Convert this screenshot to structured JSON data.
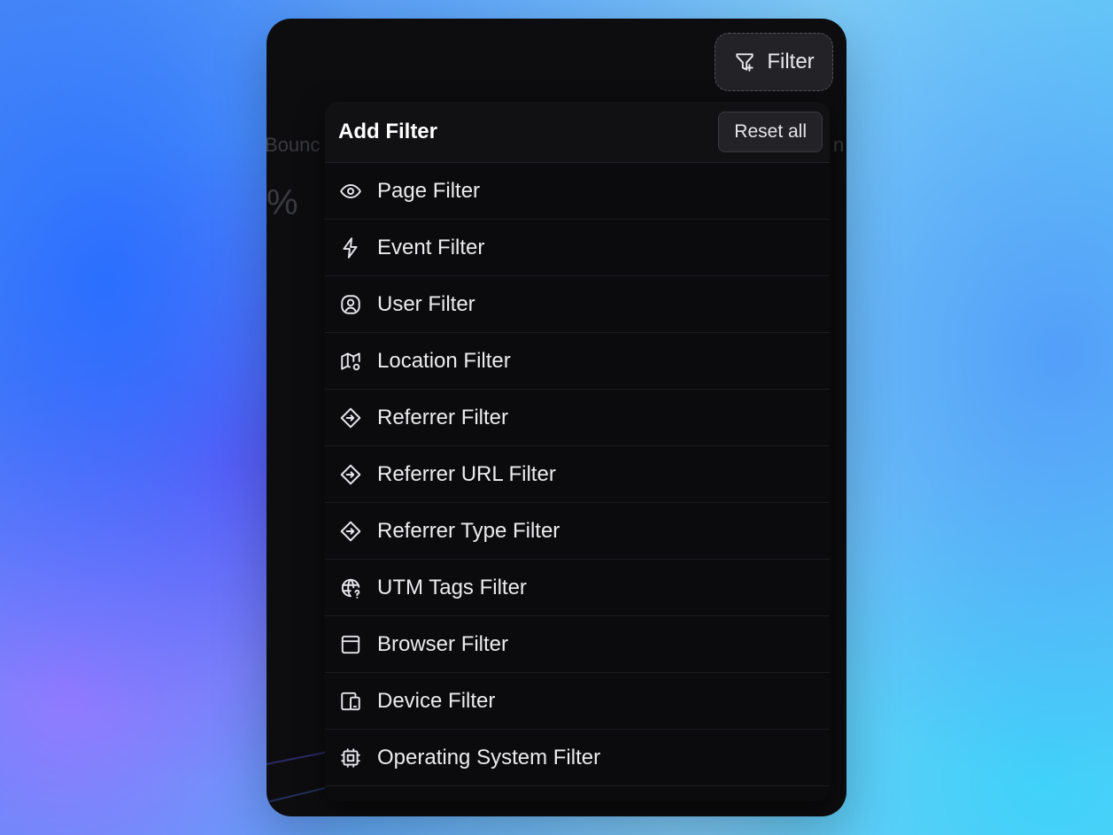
{
  "background_panel": {
    "partial_label_left": "Bounc",
    "partial_value_left": "%",
    "partial_label_right": "n"
  },
  "filter_button": {
    "label": "Filter",
    "icon": "filter-plus-icon"
  },
  "dropdown": {
    "title": "Add Filter",
    "reset_label": "Reset all",
    "items": [
      {
        "label": "Page Filter",
        "icon": "eye-icon"
      },
      {
        "label": "Event Filter",
        "icon": "bolt-icon"
      },
      {
        "label": "User Filter",
        "icon": "user-circle-icon"
      },
      {
        "label": "Location Filter",
        "icon": "map-pin-icon"
      },
      {
        "label": "Referrer Filter",
        "icon": "direction-sign-icon"
      },
      {
        "label": "Referrer URL Filter",
        "icon": "direction-sign-icon"
      },
      {
        "label": "Referrer Type Filter",
        "icon": "direction-sign-icon"
      },
      {
        "label": "UTM Tags Filter",
        "icon": "world-question-icon"
      },
      {
        "label": "Browser Filter",
        "icon": "browser-window-icon"
      },
      {
        "label": "Device Filter",
        "icon": "devices-icon"
      },
      {
        "label": "Operating System Filter",
        "icon": "cpu-icon"
      }
    ]
  },
  "colors": {
    "card_background": "#0d0d0f",
    "dropdown_background": "#0b0b0d",
    "text_primary": "#ececef"
  }
}
